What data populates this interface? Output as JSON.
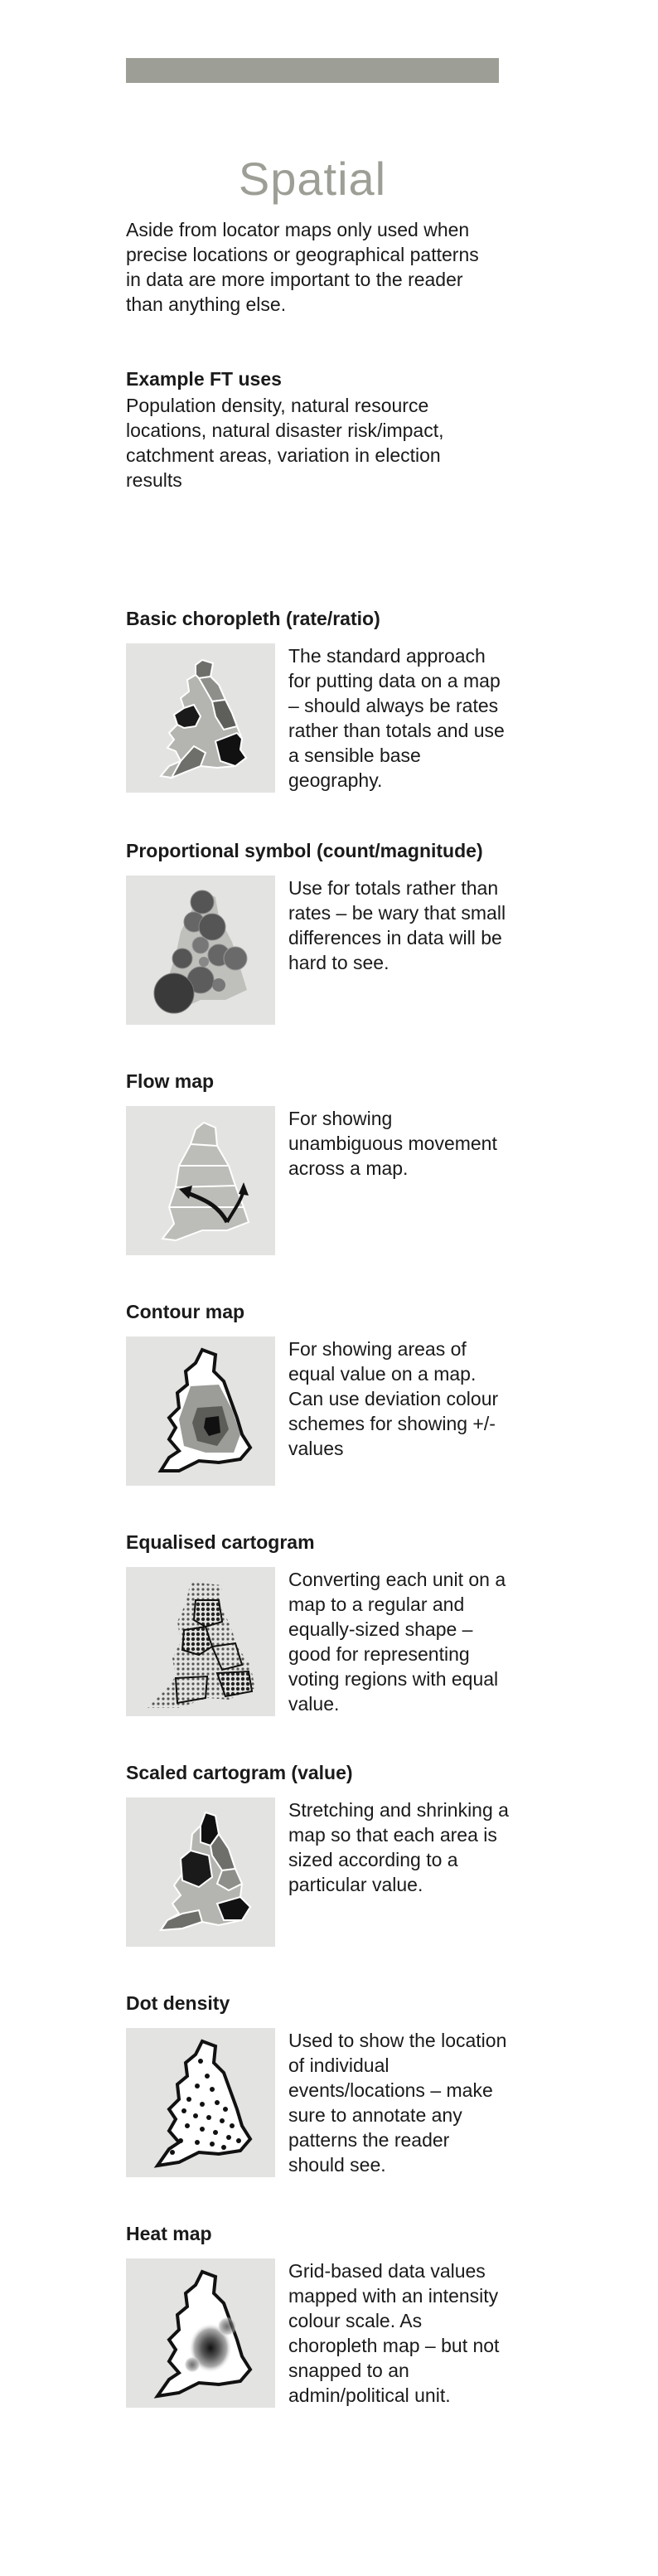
{
  "header": {
    "title": "Spatial"
  },
  "intro": "Aside from locator maps only used when precise locations or geographical patterns in data are more important to the reader than anything else.",
  "ft_uses": {
    "heading": "Example FT uses",
    "text": "Population density, natural resource locations, natural disaster risk/impact, catchment areas, variation in election results"
  },
  "colors": {
    "bar": "#9d9e95",
    "title": "#9d9e95",
    "thumb_bg": "#e3e3e1"
  },
  "sections": [
    {
      "title": "Basic choropleth (rate/ratio)",
      "description": "The standard approach for putting data on a map – should always be rates rather than totals and use a sensible base geography.",
      "icon": "choropleth-map-icon"
    },
    {
      "title": "Proportional symbol (count/magnitude)",
      "description": "Use for totals rather than rates  – be wary that small differences in data will be hard to see.",
      "icon": "proportional-symbol-map-icon"
    },
    {
      "title": "Flow map",
      "description": "For showing unambiguous movement across a map.",
      "icon": "flow-map-icon"
    },
    {
      "title": "Contour map",
      "description": "For showing areas of equal value on a map. Can use deviation colour schemes for showing +/- values",
      "icon": "contour-map-icon"
    },
    {
      "title": "Equalised cartogram",
      "description": "Converting each unit on a map to a regular and equally-sized shape – good for representing voting regions with equal value.",
      "icon": "equalised-cartogram-icon"
    },
    {
      "title": "Scaled cartogram (value)",
      "description": "Stretching and shrinking a map so that each area is sized according to a particular value.",
      "icon": "scaled-cartogram-icon"
    },
    {
      "title": "Dot density",
      "description": "Used to show the location of individual events/locations – make sure to annotate any patterns the reader should see.",
      "icon": "dot-density-map-icon"
    },
    {
      "title": "Heat map",
      "description": "Grid-based data values mapped with an intensity colour scale. As choropleth map – but not snapped to an admin/political unit.",
      "icon": "heat-map-icon"
    }
  ]
}
